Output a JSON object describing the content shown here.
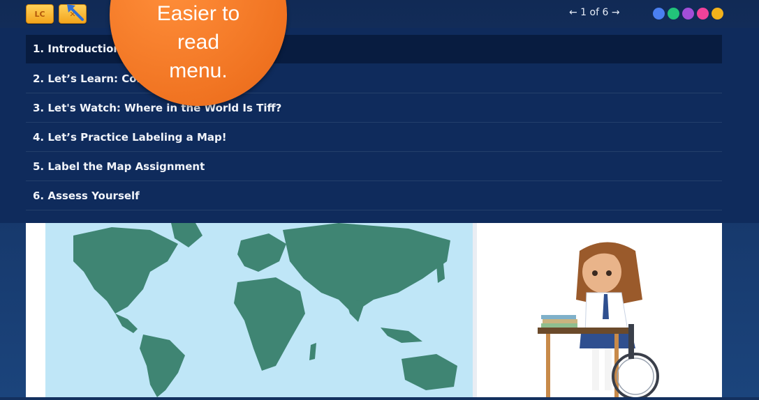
{
  "toolbar": {
    "lc_label": "LC",
    "close_label": "✕",
    "pager_text": "← 1 of 6 →",
    "progress_dots": [
      "#4a7ff0",
      "#22c37a",
      "#a24ed8",
      "#f0429a",
      "#f3b21b"
    ]
  },
  "menu": {
    "items": [
      {
        "label": "1. Introduction",
        "active": true
      },
      {
        "label": "2. Let’s Learn: Continents and Oceans",
        "active": false
      },
      {
        "label": "3. Let's Watch: Where in the World Is Tiff?",
        "active": false
      },
      {
        "label": "4. Let’s Practice Labeling a Map!",
        "active": false
      },
      {
        "label": "5. Label the Map Assignment",
        "active": false
      },
      {
        "label": "6. Assess Yourself",
        "active": false
      }
    ]
  },
  "callout": {
    "lines": [
      "Easier to",
      "read",
      "menu."
    ]
  },
  "colors": {
    "menu_bg": "#0f2b5c",
    "map_ocean": "#bfe6f7",
    "map_land": "#3f8573",
    "callout": "#f07321"
  }
}
